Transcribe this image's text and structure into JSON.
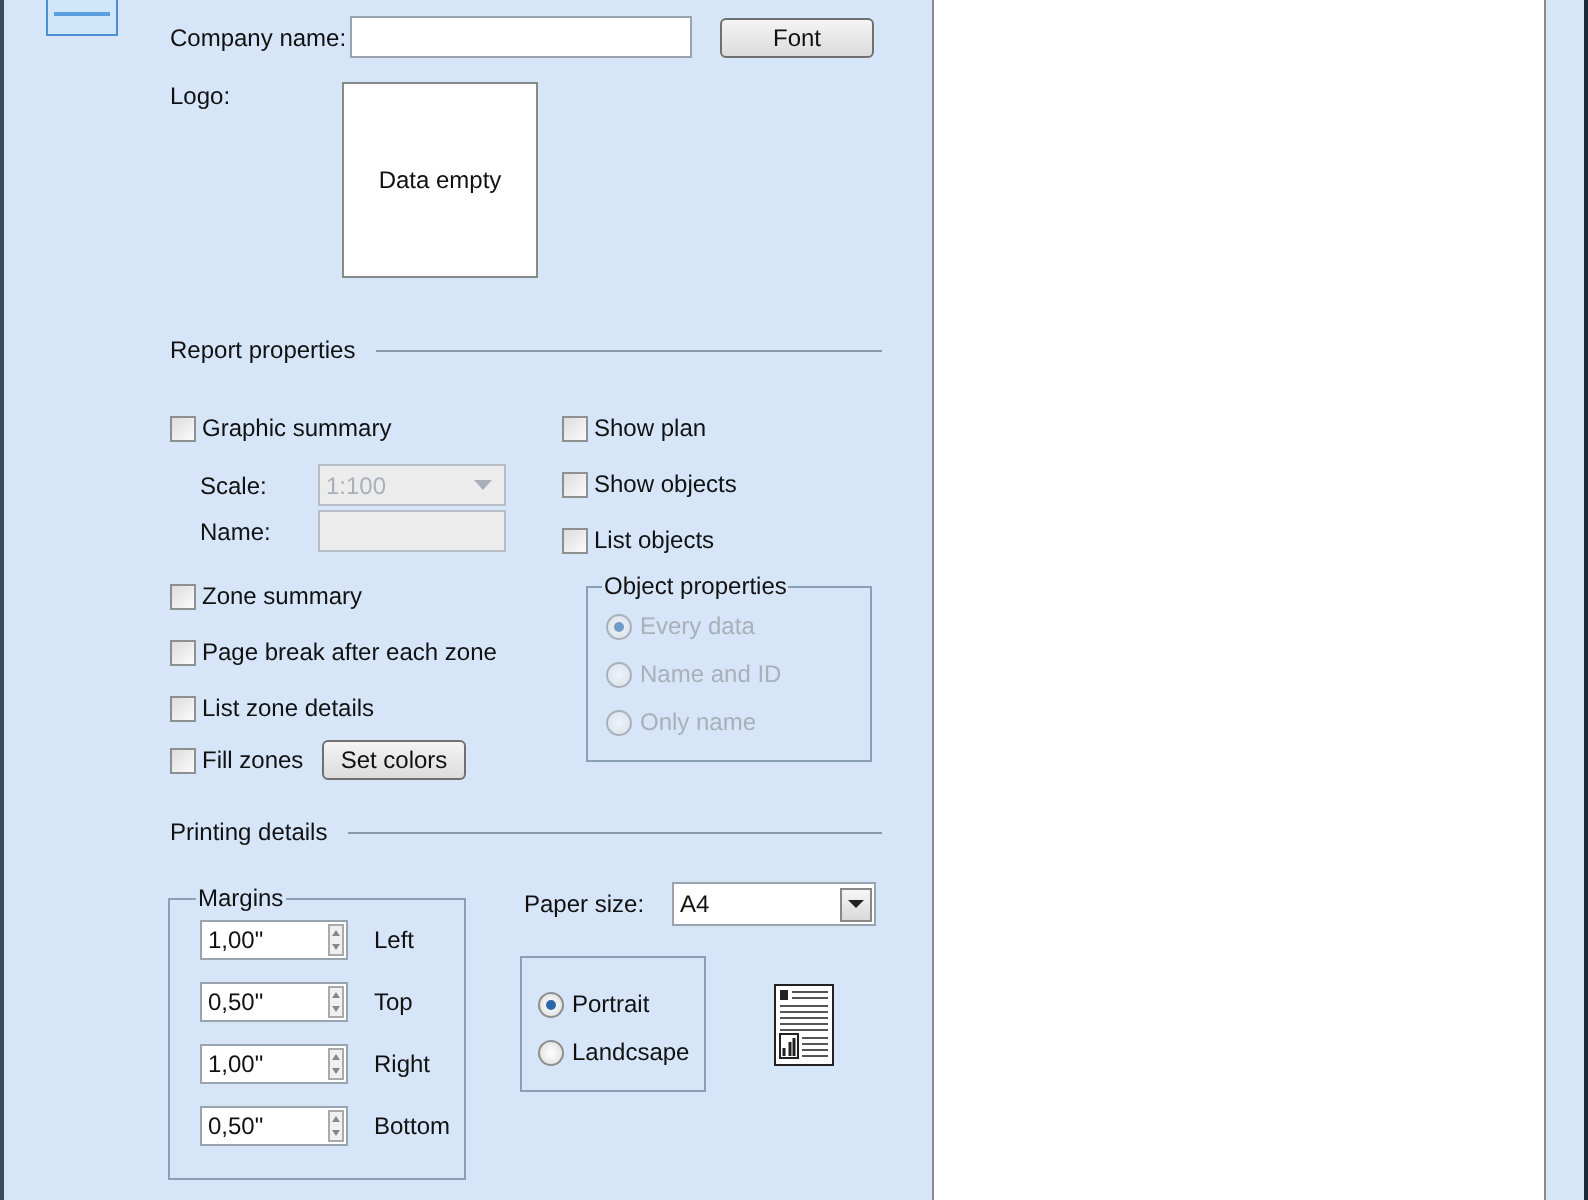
{
  "company": {
    "label": "Company name:",
    "button": "Font"
  },
  "logo": {
    "label": "Logo:",
    "empty_text": "Data empty"
  },
  "report": {
    "title": "Report properties",
    "graphic_summary": {
      "label": "Graphic summary",
      "checked": false
    },
    "scale": {
      "label": "Scale:",
      "value": "1:100",
      "disabled": true
    },
    "name": {
      "label": "Name:",
      "disabled": true
    },
    "options": [
      {
        "label": "Zone summary",
        "checked": false
      },
      {
        "label": "Page break after each zone",
        "checked": false
      },
      {
        "label": "List zone details",
        "checked": false
      }
    ],
    "fill_zones": {
      "label": "Fill zones",
      "checked": false,
      "button": "Set colors"
    },
    "object_options": [
      {
        "label": "Show plan",
        "checked": false
      },
      {
        "label": "Show objects",
        "checked": false
      },
      {
        "label": "List objects",
        "checked": false
      }
    ],
    "object_properties": {
      "title": "Object properties",
      "disabled": true,
      "choices": [
        {
          "label": "Every data",
          "selected": true
        },
        {
          "label": "Name and ID",
          "selected": false
        },
        {
          "label": "Only name",
          "selected": false
        }
      ]
    }
  },
  "printing": {
    "title": "Printing details",
    "margins": {
      "title": "Margins",
      "items": [
        {
          "value": "1,00\"",
          "label": "Left"
        },
        {
          "value": "0,50\"",
          "label": "Top"
        },
        {
          "value": "1,00\"",
          "label": "Right"
        },
        {
          "value": "0,50\"",
          "label": "Bottom"
        }
      ]
    },
    "paper_size": {
      "label": "Paper size:",
      "value": "A4"
    },
    "orientation": {
      "choices": [
        {
          "label": "Portrait",
          "selected": true
        },
        {
          "label": "Landcsape",
          "selected": false
        }
      ]
    }
  }
}
